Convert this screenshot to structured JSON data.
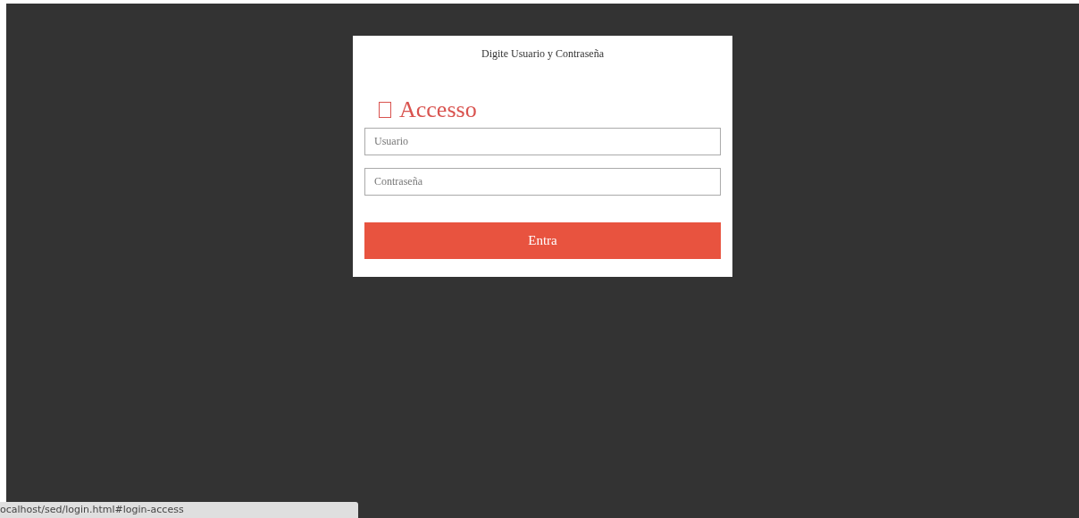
{
  "login": {
    "prompt": "Digite Usuario y Contraseña",
    "heading": "Accesso",
    "fields": [
      {
        "placeholder": "Usuario"
      },
      {
        "placeholder": "Contraseña"
      }
    ],
    "button": "Entra"
  },
  "status_bar": {
    "url": "ocalhost/sed/login.html#login-access"
  }
}
